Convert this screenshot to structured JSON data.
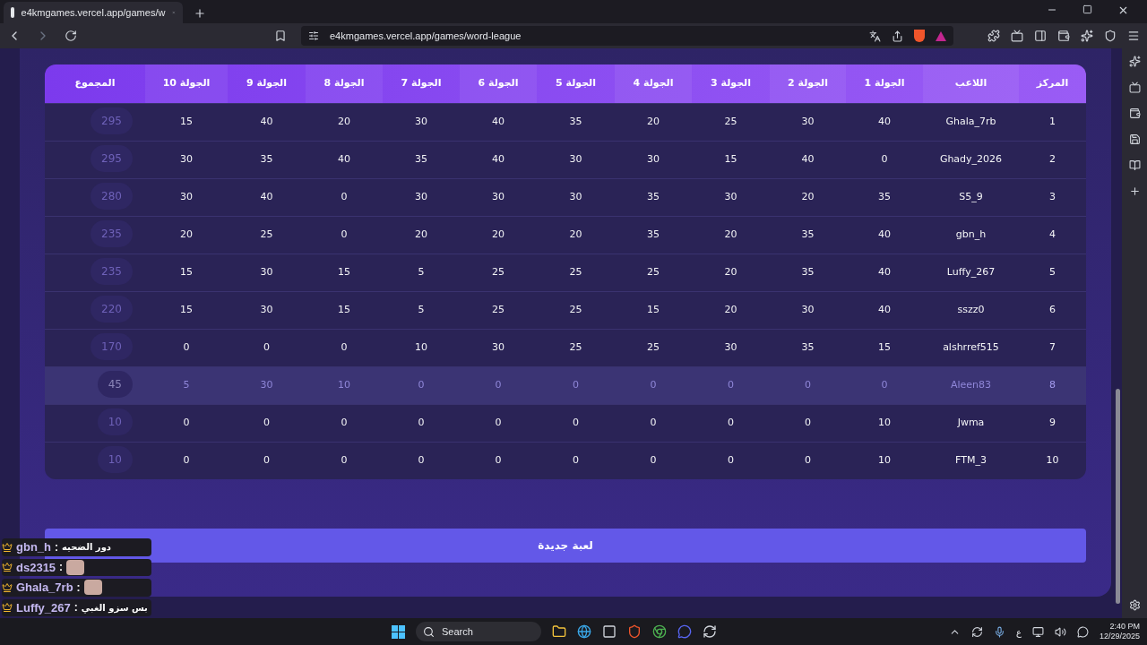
{
  "browser": {
    "tab_title": "e4kmgames.vercel.app/games/w",
    "url": "e4kmgames.vercel.app/games/word-league"
  },
  "table": {
    "columns": [
      "المركز",
      "اللاعب",
      "الجولة 1",
      "الجولة 2",
      "الجولة 3",
      "الجولة 4",
      "الجولة 5",
      "الجولة 6",
      "الجولة 7",
      "الجولة 8",
      "الجولة 9",
      "الجولة 10",
      "المجموع"
    ],
    "rows": [
      {
        "rank": "1",
        "player": "Ghala_7rb",
        "rounds": [
          "40",
          "30",
          "25",
          "20",
          "35",
          "40",
          "30",
          "20",
          "40",
          "15"
        ],
        "total": "295",
        "selected": false
      },
      {
        "rank": "2",
        "player": "Ghady_2026",
        "rounds": [
          "0",
          "40",
          "15",
          "30",
          "30",
          "40",
          "35",
          "40",
          "35",
          "30"
        ],
        "total": "295",
        "selected": false
      },
      {
        "rank": "3",
        "player": "S5_9",
        "rounds": [
          "35",
          "20",
          "30",
          "35",
          "30",
          "30",
          "30",
          "0",
          "40",
          "30"
        ],
        "total": "280",
        "selected": false
      },
      {
        "rank": "4",
        "player": "gbn_h",
        "rounds": [
          "40",
          "35",
          "20",
          "35",
          "20",
          "20",
          "20",
          "0",
          "25",
          "20"
        ],
        "total": "235",
        "selected": false
      },
      {
        "rank": "5",
        "player": "Luffy_267",
        "rounds": [
          "40",
          "35",
          "20",
          "25",
          "25",
          "25",
          "5",
          "15",
          "30",
          "15"
        ],
        "total": "235",
        "selected": false
      },
      {
        "rank": "6",
        "player": "sszz0",
        "rounds": [
          "40",
          "30",
          "20",
          "15",
          "25",
          "25",
          "5",
          "15",
          "30",
          "15"
        ],
        "total": "220",
        "selected": false
      },
      {
        "rank": "7",
        "player": "alshrref515",
        "rounds": [
          "15",
          "35",
          "30",
          "25",
          "25",
          "30",
          "10",
          "0",
          "0",
          "0"
        ],
        "total": "170",
        "selected": false
      },
      {
        "rank": "8",
        "player": "Aleen83",
        "rounds": [
          "0",
          "0",
          "0",
          "0",
          "0",
          "0",
          "0",
          "10",
          "30",
          "5"
        ],
        "total": "45",
        "selected": true
      },
      {
        "rank": "9",
        "player": "Jwma",
        "rounds": [
          "10",
          "0",
          "0",
          "0",
          "0",
          "0",
          "0",
          "0",
          "0",
          "0"
        ],
        "total": "10",
        "selected": false
      },
      {
        "rank": "10",
        "player": "FTM_3",
        "rounds": [
          "10",
          "0",
          "0",
          "0",
          "0",
          "0",
          "0",
          "0",
          "0",
          "0"
        ],
        "total": "10",
        "selected": false
      }
    ]
  },
  "new_game_button": "لعبة جديدة",
  "chat": [
    {
      "user": "gbn_h",
      "separator": ":",
      "message": "دور الضحيه",
      "emote": false
    },
    {
      "user": "ds2315",
      "separator": ":",
      "emote": true
    },
    {
      "user": "Ghala_7rb",
      "separator": ":",
      "emote": true
    },
    {
      "user": "Luffy_267",
      "separator": ":",
      "message": "بس سزو الغبي",
      "emote": false
    }
  ],
  "taskbar": {
    "search": "Search",
    "time": "2:40 PM",
    "date": "12/29/2025",
    "lang": "ع"
  }
}
